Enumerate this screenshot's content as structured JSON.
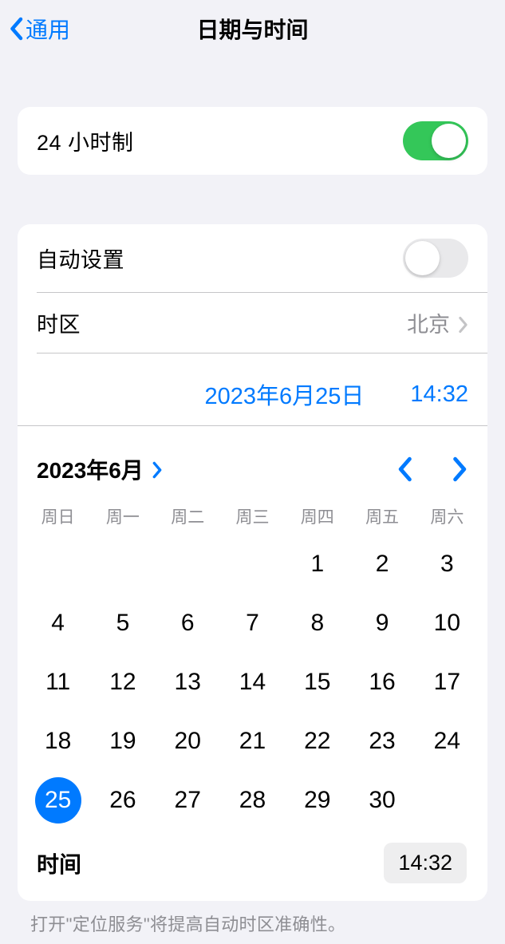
{
  "nav": {
    "back_label": "通用",
    "title": "日期与时间"
  },
  "group1": {
    "label_24h": "24 小时制",
    "value_24h": true
  },
  "group2": {
    "auto_set_label": "自动设置",
    "auto_set_value": false,
    "timezone_label": "时区",
    "timezone_value": "北京",
    "selected_date": "2023年6月25日",
    "selected_time": "14:32"
  },
  "calendar": {
    "month_label": "2023年6月",
    "weekdays": [
      "周日",
      "周一",
      "周二",
      "周三",
      "周四",
      "周五",
      "周六"
    ],
    "leading_blanks": 4,
    "days_in_month": 30,
    "selected_day": 25,
    "time_label": "时间",
    "time_value": "14:32"
  },
  "footer": {
    "text": "打开\"定位服务\"将提高自动时区准确性。"
  }
}
